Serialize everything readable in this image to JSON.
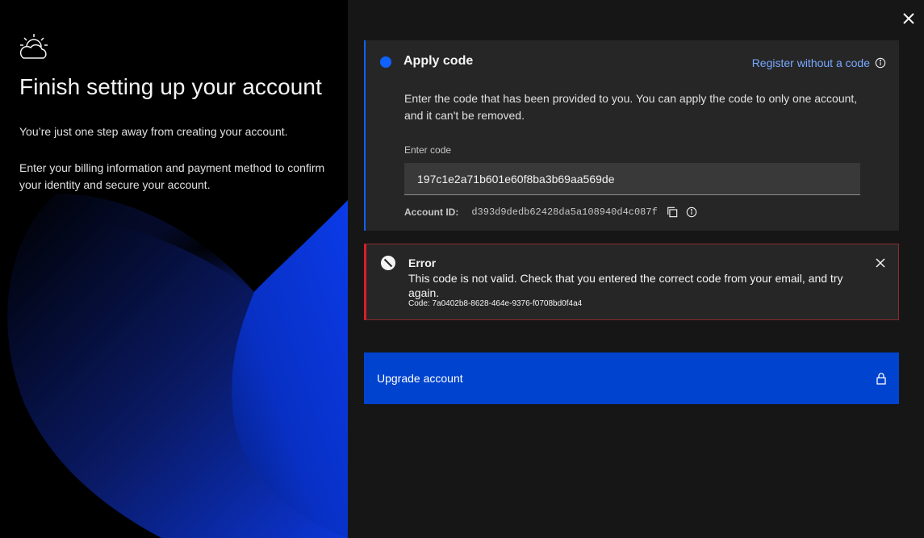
{
  "left": {
    "title": "Finish setting up your account",
    "paragraph1": "You’re just one step away from creating your account.",
    "paragraph2": "Enter your billing information and payment method to confirm your identity and secure your account.",
    "logo_icon": "cloud-sun-icon"
  },
  "apply_code": {
    "title": "Apply code",
    "register_link": "Register without a code",
    "description": "Enter the code that has been provided to you. You can apply the code to only one account, and it can't be removed.",
    "code_label": "Enter code",
    "code_value": "197c1e2a71b601e60f8ba3b69aa569de",
    "account_id_label": "Account ID:",
    "account_id_value": "d393d9dedb62428da5a108940d4c087f",
    "accent_color": "#0f62fe"
  },
  "error": {
    "title": "Error",
    "message": "This code is not valid. Check that you entered the correct code from your email, and try again.",
    "code": "Code: 7a0402b8-8628-464e-9376-f0708bd0f4a4",
    "color": "#da1e28"
  },
  "upgrade": {
    "label": "Upgrade account",
    "icon": "lock-icon",
    "color": "#0043ce"
  },
  "colors": {
    "left_bg": "#000000",
    "right_bg": "#161616",
    "link": "#78a9ff"
  }
}
